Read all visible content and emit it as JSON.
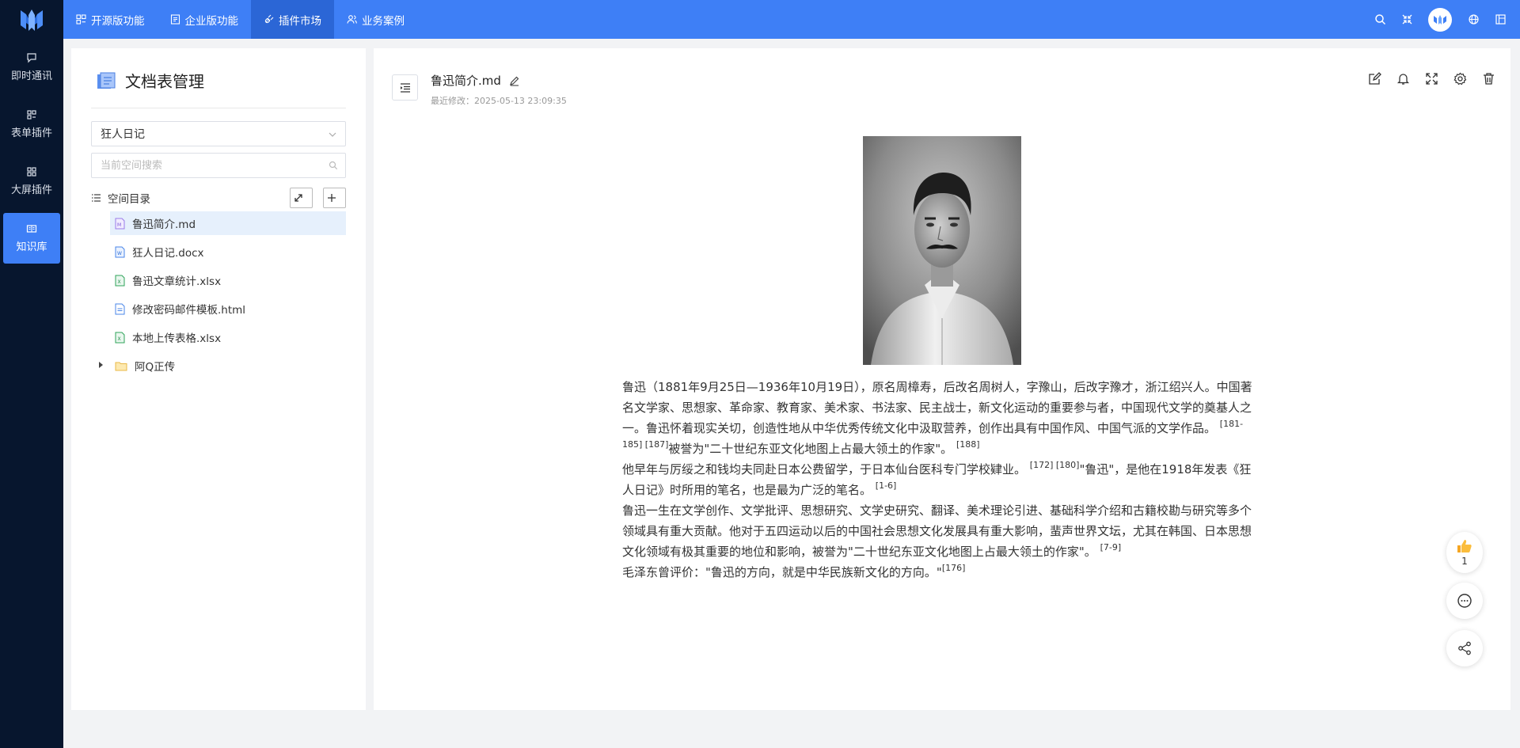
{
  "topnav": {
    "items": [
      {
        "label": "开源版功能",
        "icon": "grid-icon"
      },
      {
        "label": "企业版功能",
        "icon": "document-icon"
      },
      {
        "label": "插件市场",
        "icon": "plug-icon"
      },
      {
        "label": "业务案例",
        "icon": "users-icon"
      }
    ],
    "active_index": 2
  },
  "sidebar": {
    "items": [
      {
        "label": "即时通讯",
        "icon": "chat-icon"
      },
      {
        "label": "表单插件",
        "icon": "form-icon"
      },
      {
        "label": "大屏插件",
        "icon": "dashboard-icon"
      },
      {
        "label": "知识库",
        "icon": "book-icon"
      }
    ],
    "active_index": 3
  },
  "left_panel": {
    "title": "文档表管理",
    "space_select": "狂人日记",
    "search_placeholder": "当前空间搜索",
    "tree_title": "空间目录",
    "files": [
      {
        "name": "鲁迅简介.md",
        "type": "md"
      },
      {
        "name": "狂人日记.docx",
        "type": "docx"
      },
      {
        "name": "鲁迅文章统计.xlsx",
        "type": "xlsx"
      },
      {
        "name": "修改密码邮件模板.html",
        "type": "html"
      },
      {
        "name": "本地上传表格.xlsx",
        "type": "xlsx"
      }
    ],
    "folder": "阿Q正传"
  },
  "document": {
    "title": "鲁迅简介.md",
    "meta": "最近修改：2025-05-13 23:09:35",
    "paragraphs": [
      {
        "text": "鲁迅（1881年9月25日—1936年10月19日），原名周樟寿，后改名周树人，字豫山，后改字豫才，浙江绍兴人。中国著名文学家、思想家、革命家、教育家、美术家、书法家、民主战士，新文化运动的重要参与者，中国现代文学的奠基人之一。鲁迅怀着现实关切，创造性地从中华优秀传统文化中汲取营养，创作出具有中国作风、中国气派的文学作品。",
        "sup1": "[181-185] [187]",
        "text2": "被誉为\"二十世纪东亚文化地图上占最大领土的作家\"。",
        "sup2": "[188]"
      },
      {
        "text": "他早年与厉绥之和钱均夫同赴日本公费留学，于日本仙台医科专门学校肄业。",
        "sup1": "[172] [180]",
        "text2": "\"鲁迅\"，是他在1918年发表《狂人日记》时所用的笔名，也是最为广泛的笔名。",
        "sup2": "[1-6]"
      },
      {
        "text": "鲁迅一生在文学创作、文学批评、思想研究、文学史研究、翻译、美术理论引进、基础科学介绍和古籍校勘与研究等多个领域具有重大贡献。他对于五四运动以后的中国社会思想文化发展具有重大影响，蜚声世界文坛，尤其在韩国、日本思想文化领域有极其重要的地位和影响，被誉为\"二十世纪东亚文化地图上占最大领土的作家\"。",
        "sup1": "[7-9]",
        "text2": "",
        "sup2": ""
      },
      {
        "text": "毛泽东曾评价：\"鲁迅的方向，就是中华民族新文化的方向。\"",
        "sup1": "[176]",
        "text2": "",
        "sup2": ""
      }
    ]
  },
  "floating": {
    "like_count": "1"
  },
  "colors": {
    "primary": "#3e7ff6",
    "sidebar_bg": "#07162e",
    "active_nav": "#2b66d6",
    "tree_active": "#e6f0fc"
  }
}
